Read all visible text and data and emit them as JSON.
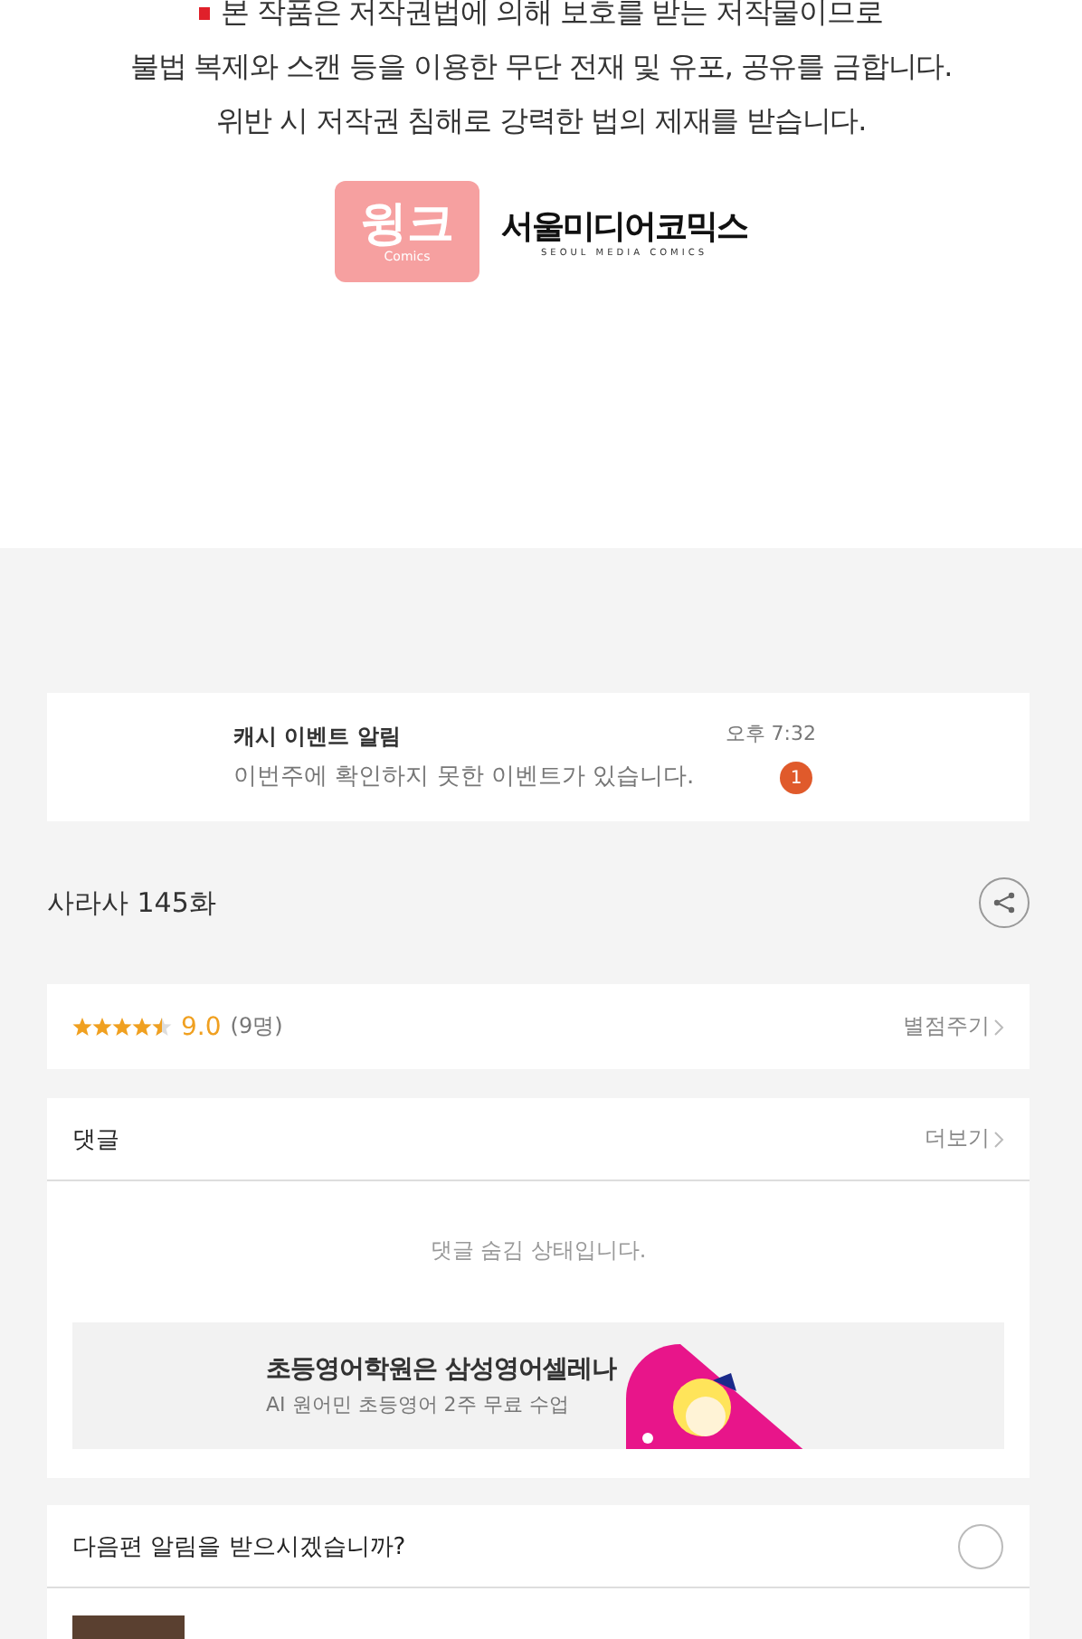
{
  "notice": {
    "lines": [
      "본 작품은 저작권법에 의해 보호를 받는 저작물이므로",
      "불법 복제와 스캔 등을 이용한 무단 전재 및 유포, 공유를 금합니다.",
      "위반 시 저작권 침해로 강력한 법의 제재를 받습니다."
    ]
  },
  "logos": {
    "wink": "윙크",
    "wink_sub": "Comics",
    "seoul": "서울미디어코믹스",
    "seoul_sub": "SEOUL MEDIA COMICS"
  },
  "event": {
    "title": "캐시 이벤트 알림",
    "message": "이번주에 확인하지 못한 이벤트가 있습니다.",
    "time": "오후 7:32",
    "badge": "1"
  },
  "episode": {
    "title": "사라사 145화"
  },
  "rating": {
    "stars": 4.5,
    "score": "9.0",
    "count": "(9명)",
    "action": "별점주기"
  },
  "comments": {
    "title": "댓글",
    "more": "더보기",
    "status": "댓글 숨김 상태입니다."
  },
  "ad": {
    "title": "초등영어학원은 삼성영어셀레나",
    "subtitle": "AI 원어민 초등영어 2주 무료 수업"
  },
  "next": {
    "question": "다음편 알림을 받으시겠습니까?"
  }
}
